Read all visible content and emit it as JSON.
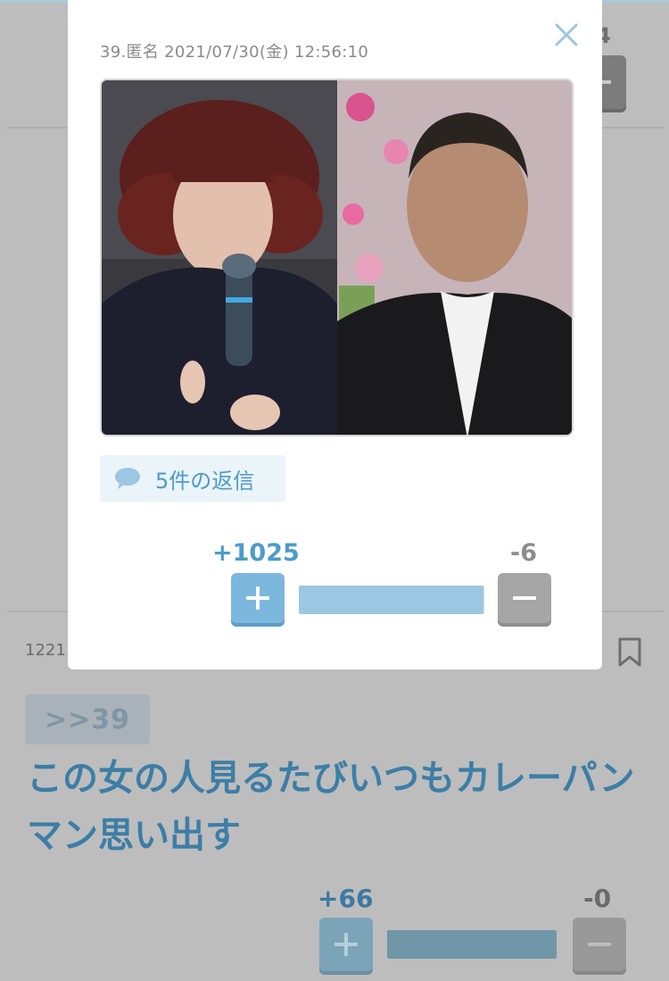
{
  "modal": {
    "comment_meta": "39.匿名 2021/07/30(金) 12:56:10",
    "close_icon": "close-x-icon",
    "photo_alt_icon": "photo-two-people",
    "reply_button": {
      "icon": "speech-bubble-icon",
      "label": "5件の返信"
    },
    "votes": {
      "plus": "+1025",
      "minus": "-6",
      "plus_share": 0.994
    }
  },
  "background": {
    "top_vote_count": "4",
    "comment_number": "1221",
    "bookmark_icon": "bookmark-icon",
    "anchor": ">>39",
    "comment_text": "この女の人見るたびいつもカレーパンマン思い出す",
    "votes": {
      "plus": "+66",
      "minus": "-0",
      "plus_share": 1.0
    }
  },
  "colors": {
    "accent_blue": "#4c9bc9",
    "overlay": "#bdbdbd",
    "vote_plus": "#7cb7de",
    "vote_minus": "#a6a6a6"
  }
}
